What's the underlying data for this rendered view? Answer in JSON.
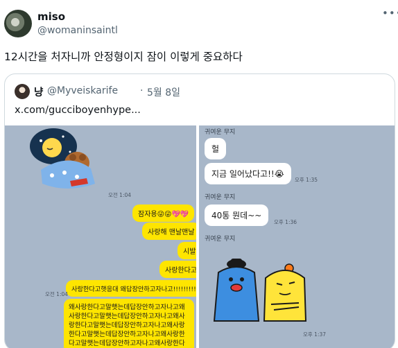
{
  "tweet": {
    "display_name": "miso",
    "handle": "@womaninsaintl",
    "text": "12시간을 처자니까 안정형이지 잠이 이렇게 중요하다"
  },
  "quote": {
    "display_name": "냥",
    "handle": "@Myveiskarife",
    "separator": "·",
    "date": "5월 8일",
    "link": "x.com/gucciboyenhype..."
  },
  "chat_left": {
    "sticker_time": "오전 1:04",
    "bubbles": [
      "잠자용😜😜💖💖",
      "사랑해 맨날맨날",
      "시발",
      "사랑한다고",
      "사랑한다고햇응대 왜답장안하고자나고!!!!!!!!!'"
    ],
    "last_time": "오전 1:04",
    "long_message": "왜사랑한다고말햇는데답장안하고자나고왜사랑한다고말햇는데답장안하고자나고왜사랑한다고말햇는데답장안하고자나고왜사랑한다고말햇는데답장안하고자나고왜사랑한다고말햇는데답장안하고자나고왜사랑한다고말햇는데답장안하고자나고왜사랑한다고말햇는데답장"
  },
  "chat_right": {
    "sender": "귀여운 무지",
    "msg1": "헐",
    "msg2": "지금 일어났다고!!😭",
    "time1": "오후 1:35",
    "msg3": "40통 뭔데~~",
    "time2": "오후 1:36",
    "time3": "오후 1:37"
  },
  "colors": {
    "chat_bg": "#a8b7c9",
    "bubble_yellow": "#fee500",
    "muted": "#536471"
  }
}
